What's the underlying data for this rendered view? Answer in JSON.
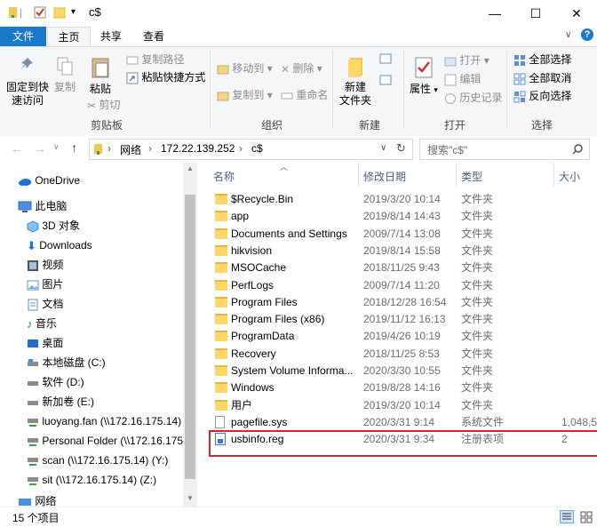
{
  "window": {
    "title": "c$",
    "minimize_glyph": "—",
    "maximize_glyph": "☐",
    "close_glyph": "✕"
  },
  "ribbon_tabs": [
    "文件",
    "主页",
    "共享",
    "查看"
  ],
  "ribbon": {
    "pin_label_1": "固定到快",
    "pin_label_2": "速访问",
    "copy_label": "复制",
    "paste_label": "粘贴",
    "copy_path": "复制路径",
    "paste_shortcut": "粘贴快捷方式",
    "cut": "剪切",
    "clipboard_group": "剪贴板",
    "move_to": "移动到",
    "copy_to": "复制到",
    "delete": "删除",
    "rename": "重命名",
    "organize_group": "组织",
    "new_folder_1": "新建",
    "new_folder_2": "文件夹",
    "new_group": "新建",
    "properties": "属性",
    "open": "打开",
    "edit": "编辑",
    "history": "历史记录",
    "open_group": "打开",
    "select_all": "全部选择",
    "select_none": "全部取消",
    "invert_select": "反向选择",
    "select_group": "选择"
  },
  "address": {
    "crumbs": [
      "网络",
      "172.22.139.252",
      "c$"
    ],
    "search_placeholder": "搜索\"c$\""
  },
  "nav_pane": {
    "items": [
      "OneDrive",
      "此电脑",
      "3D 对象",
      "Downloads",
      "视频",
      "图片",
      "文档",
      "音乐",
      "桌面",
      "本地磁盘 (C:)",
      "软件 (D:)",
      "新加卷 (E:)",
      "luoyang.fan (\\\\172.16.175.14)",
      "Personal Folder (\\\\172.16.175",
      "scan (\\\\172.16.175.14) (Y:)",
      "sit (\\\\172.16.175.14) (Z:)",
      "网络"
    ]
  },
  "columns": {
    "name": "名称",
    "modified": "修改日期",
    "type": "类型",
    "size": "大小"
  },
  "files": [
    {
      "name": "$Recycle.Bin",
      "date": "2019/3/20 10:14",
      "type": "文件夹",
      "size": ""
    },
    {
      "name": "app",
      "date": "2019/8/14 14:43",
      "type": "文件夹",
      "size": ""
    },
    {
      "name": "Documents and Settings",
      "date": "2009/7/14 13:08",
      "type": "文件夹",
      "size": ""
    },
    {
      "name": "hikvision",
      "date": "2019/8/14 15:58",
      "type": "文件夹",
      "size": ""
    },
    {
      "name": "MSOCache",
      "date": "2018/11/25 9:43",
      "type": "文件夹",
      "size": ""
    },
    {
      "name": "PerfLogs",
      "date": "2009/7/14 11:20",
      "type": "文件夹",
      "size": ""
    },
    {
      "name": "Program Files",
      "date": "2018/12/28 16:54",
      "type": "文件夹",
      "size": ""
    },
    {
      "name": "Program Files (x86)",
      "date": "2019/11/12 16:13",
      "type": "文件夹",
      "size": ""
    },
    {
      "name": "ProgramData",
      "date": "2019/4/26 10:19",
      "type": "文件夹",
      "size": ""
    },
    {
      "name": "Recovery",
      "date": "2018/11/25 8:53",
      "type": "文件夹",
      "size": ""
    },
    {
      "name": "System Volume Informa...",
      "date": "2020/3/30 10:55",
      "type": "文件夹",
      "size": ""
    },
    {
      "name": "Windows",
      "date": "2019/8/28 14:16",
      "type": "文件夹",
      "size": ""
    },
    {
      "name": "用户",
      "date": "2019/3/20 10:14",
      "type": "文件夹",
      "size": ""
    },
    {
      "name": "pagefile.sys",
      "date": "2020/3/31 9:14",
      "type": "系统文件",
      "size": "1,048,5"
    },
    {
      "name": "usbinfo.reg",
      "date": "2020/3/31 9:34",
      "type": "注册表项",
      "size": "2"
    }
  ],
  "status": {
    "item_count": "15 个项目"
  }
}
